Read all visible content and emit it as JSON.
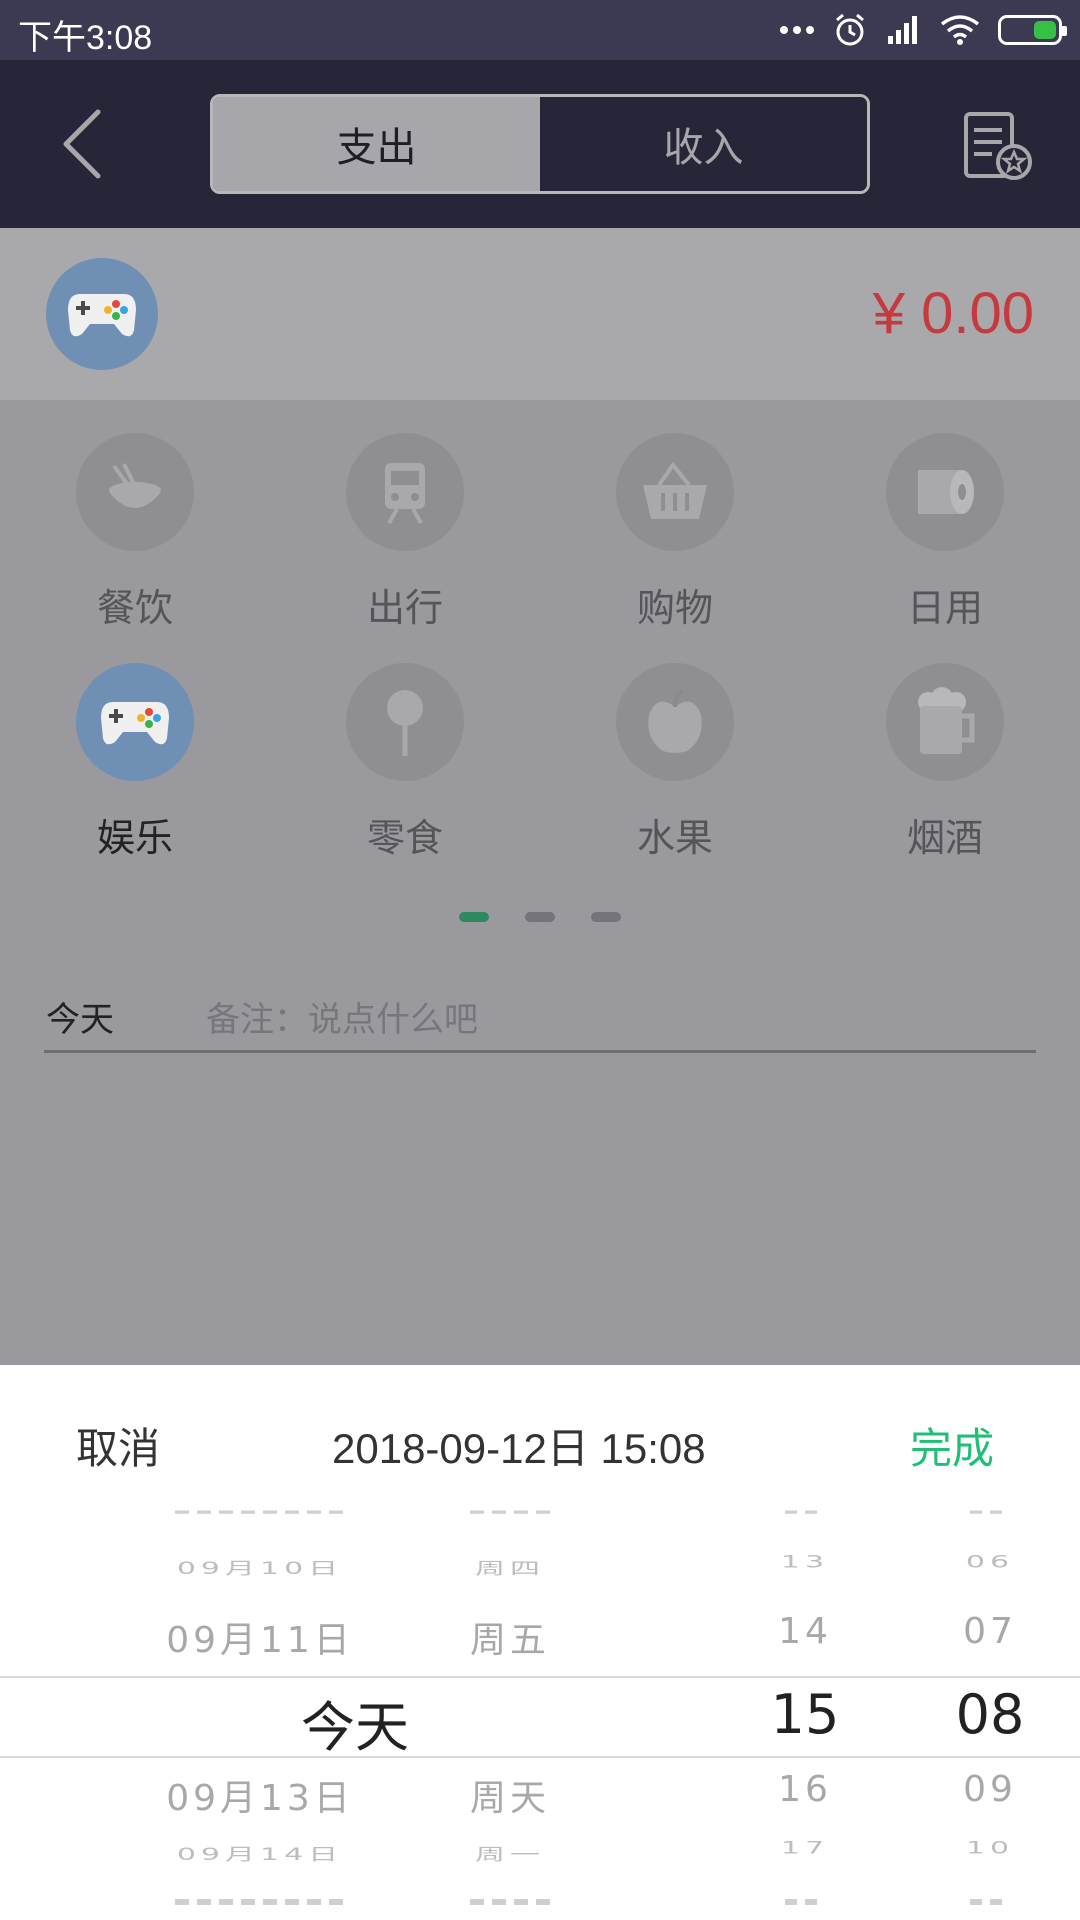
{
  "status_bar": {
    "time": "下午3:08",
    "icons": [
      "more-dots-icon",
      "alarm-icon",
      "signal-icon",
      "wifi-icon",
      "battery-icon"
    ]
  },
  "header": {
    "tabs": [
      {
        "label": "支出",
        "active": true
      },
      {
        "label": "收入",
        "active": false
      }
    ],
    "back_icon": "chevron-left-icon",
    "bill_icon": "bill-star-icon"
  },
  "current": {
    "icon": "gamepad-icon",
    "amount": "¥ 0.00"
  },
  "categories": [
    {
      "label": "餐饮",
      "icon": "rice-bowl-icon",
      "selected": false
    },
    {
      "label": "出行",
      "icon": "train-icon",
      "selected": false
    },
    {
      "label": "购物",
      "icon": "basket-icon",
      "selected": false
    },
    {
      "label": "日用",
      "icon": "tissue-roll-icon",
      "selected": false
    },
    {
      "label": "娱乐",
      "icon": "gamepad-icon",
      "selected": true
    },
    {
      "label": "零食",
      "icon": "lollipop-icon",
      "selected": false
    },
    {
      "label": "水果",
      "icon": "apple-icon",
      "selected": false
    },
    {
      "label": "烟酒",
      "icon": "beer-mug-icon",
      "selected": false
    }
  ],
  "pager": {
    "pages": 3,
    "current": 1
  },
  "note": {
    "date_label": "今天",
    "placeholder": "备注：说点什么吧"
  },
  "picker": {
    "cancel": "取消",
    "value": "2018-09-12日   15:08",
    "done": "完成",
    "rows": [
      {
        "date": "09月10日",
        "week": "周四",
        "hour": "13",
        "minute": "06"
      },
      {
        "date": "09月11日",
        "week": "周五",
        "hour": "14",
        "minute": "07"
      },
      {
        "date": "今天",
        "week": "",
        "hour": "15",
        "minute": "08"
      },
      {
        "date": "09月13日",
        "week": "周天",
        "hour": "16",
        "minute": "09"
      },
      {
        "date": "09月14日",
        "week": "周一",
        "hour": "17",
        "minute": "10"
      }
    ]
  },
  "colors": {
    "header_bg": "#272638",
    "amount": "#c43a3f",
    "done": "#1fbf75",
    "pager_active": "#2e8a5e",
    "selected_icon_bg": "#6f8fb5"
  }
}
